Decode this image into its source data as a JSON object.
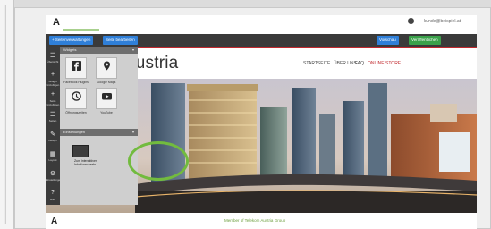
{
  "arrow_color": "#8cc63f",
  "highlight_color": "#72bb3e",
  "editor": {
    "brand": "A",
    "user_email": "kunde@beispiel.at",
    "buttons": {
      "admin": "+ Seitenverwaltungen",
      "settings": "Seite bearbeiten",
      "preview": "Vorschau",
      "publish": "Veröffentlichen"
    },
    "sidebar": [
      {
        "icon": "menu-icon",
        "glyph": "☰",
        "label": "Übersicht"
      },
      {
        "icon": "plus-icon",
        "glyph": "+",
        "label": "Widget hinzufügen"
      },
      {
        "icon": "plus-icon",
        "glyph": "+",
        "label": "Seite hinzufügen"
      },
      {
        "icon": "list-icon",
        "glyph": "☰",
        "label": "Seiten"
      },
      {
        "icon": "paint-icon",
        "glyph": "✎",
        "label": "Design"
      },
      {
        "icon": "layout-icon",
        "glyph": "▦",
        "label": "Layout"
      },
      {
        "icon": "gear-icon",
        "glyph": "⚙",
        "label": "Einstellungen"
      },
      {
        "icon": "help-icon",
        "glyph": "?",
        "label": "Hilfe"
      }
    ],
    "panel": {
      "section1": "Widgets",
      "section2": "Einstellungen",
      "widgets": [
        {
          "icon": "facebook-icon",
          "label": "Facebook Plugins"
        },
        {
          "icon": "map-pin-icon",
          "label": "Google Maps"
        },
        {
          "icon": "clock-icon",
          "label": "Öffnungszeiten"
        },
        {
          "icon": "youtube-icon",
          "label": "YouTube"
        }
      ],
      "highlighted_widget_label": "Zum interaktiven Inhalt wechseln"
    }
  },
  "website": {
    "logo_text": "austria",
    "menu": [
      "STARTSEITE",
      "ÜBER UNS",
      "FAQ",
      "ONLINE STORE"
    ],
    "menu_active_color": "#c0282d",
    "footer_logo": "A",
    "footer_text": "Member of Telekom Austria Group"
  }
}
